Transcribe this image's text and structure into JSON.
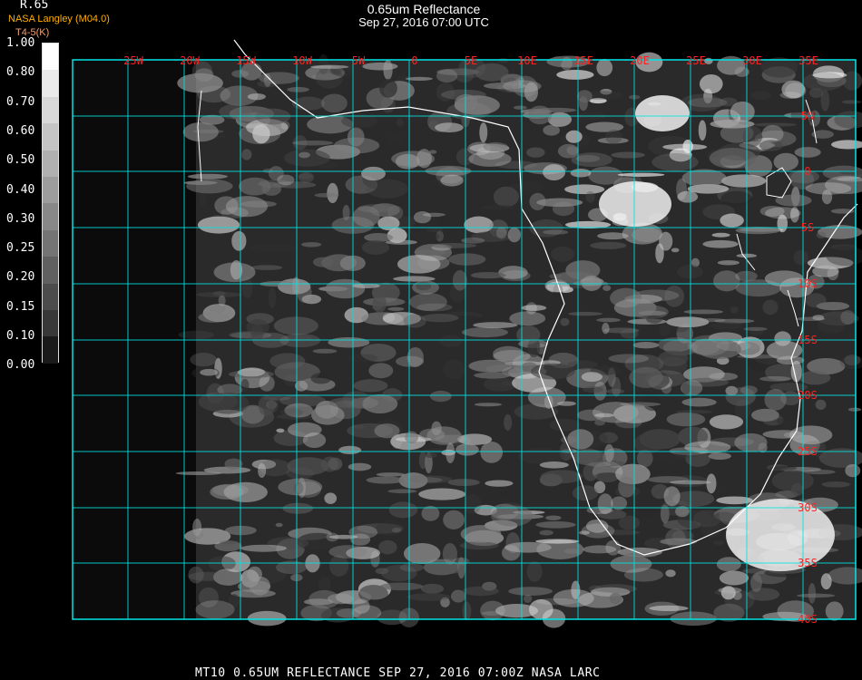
{
  "header": {
    "title": "0.65um Reflectance",
    "subtitle": "Sep 27, 2016 07:00 UTC",
    "organization": "NASA Langley (M04.0)",
    "band_label": "R.65",
    "band_sub": "T4-5(K)"
  },
  "colorbar": {
    "labels": [
      "1.00",
      "0.80",
      "0.70",
      "0.60",
      "0.50",
      "0.40",
      "0.30",
      "0.25",
      "0.20",
      "0.15",
      "0.10",
      "0.00"
    ],
    "colors": [
      "#ffffff",
      "#ebebeb",
      "#d8d8d8",
      "#c4c4c4",
      "#b0b0b0",
      "#9c9c9c",
      "#888888",
      "#747474",
      "#606060",
      "#4c4c4c",
      "#383838",
      "#1a1a1a"
    ]
  },
  "map": {
    "longitude_labels": [
      "25W",
      "20W",
      "15W",
      "10W",
      "5W",
      "0",
      "5E",
      "10E",
      "15E",
      "20E",
      "25E",
      "30E",
      "35E"
    ],
    "latitude_labels": [
      "5N",
      "0",
      "5S",
      "10S",
      "15S",
      "20S",
      "25S",
      "30S",
      "35S",
      "40S"
    ],
    "grid_color": "#00e5e5",
    "label_color": "#ff2020",
    "coast_color": "#ffffff"
  },
  "footer": {
    "text": "MT10  0.65UM REFLECTANCE   SEP 27, 2016 07:00Z   NASA LARC"
  }
}
